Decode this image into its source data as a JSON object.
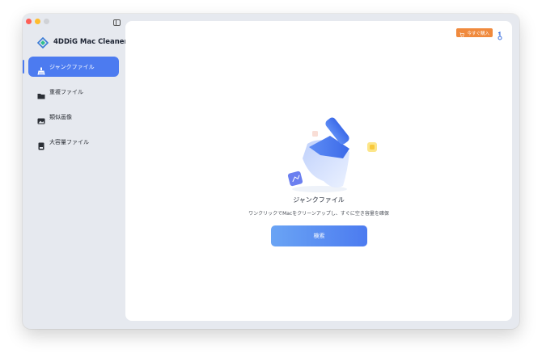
{
  "app": {
    "name": "4DDiG Mac Cleaner"
  },
  "sidebar": {
    "items": [
      {
        "label": "ジャンクファイル",
        "icon": "broom-icon",
        "active": true
      },
      {
        "label": "重複ファイル",
        "icon": "folder-icon",
        "active": false
      },
      {
        "label": "類似画像",
        "icon": "image-icon",
        "active": false
      },
      {
        "label": "大容量ファイル",
        "icon": "large-file-icon",
        "active": false
      }
    ]
  },
  "header": {
    "buy_label": "今すぐ購入",
    "buy_icon": "cart-icon",
    "account_icon": "key-icon"
  },
  "main": {
    "title": "ジャンクファイル",
    "description": "ワンクリックでMacをクリーンアップし、すぐに空き容量を確保",
    "scan_label": "検索",
    "illustration_icon": "broom-illustration"
  },
  "colors": {
    "accent": "#4c7bf0",
    "buy": "#f08a3d",
    "sidebar_bg": "#e6e9ef"
  }
}
